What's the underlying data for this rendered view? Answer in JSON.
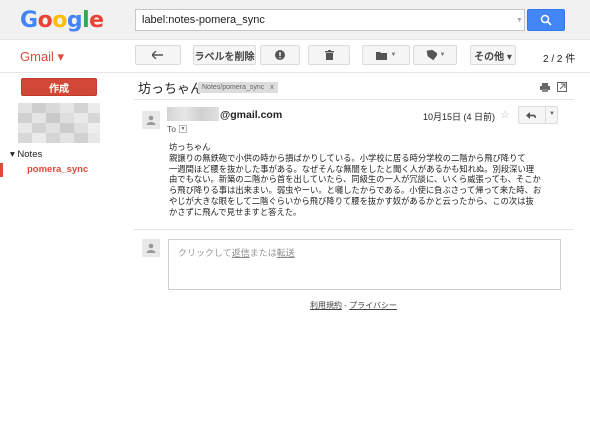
{
  "header": {
    "logo": {
      "letters": [
        "G",
        "o",
        "o",
        "g",
        "l",
        "e"
      ],
      "colors": [
        "#4285f4",
        "#ea4335",
        "#fbbc05",
        "#4285f4",
        "#34a853",
        "#ea4335"
      ]
    },
    "search_value": "label:notes-pomera_sync",
    "search_icon": "search-icon"
  },
  "toolbar": {
    "app_label": "Gmail ▾",
    "back_icon": "arrow-back-icon",
    "remove_label": "ラベルを削除",
    "report_icon": "report-spam-icon",
    "delete_icon": "trash-icon",
    "move_icon": "folder-icon",
    "labels_icon": "label-tag-icon",
    "more_label": "その他 ▾",
    "pager_text": "2 / 2 件"
  },
  "sidebar": {
    "compose_label": "作成",
    "notes_label": "▾ Notes",
    "sync_label": "pomera_sync"
  },
  "message": {
    "subject": "坊っちゃん",
    "label_chip": "Notes/pomera_sync",
    "label_chip_close": "x",
    "sender_domain": "@gmail.com",
    "to_label": "To",
    "date": "10月15日 (4 日前)",
    "star": "☆",
    "body_title": "坊っちゃん",
    "body_lines": [
      "親譲りの無鉄砲で小供の時から損ばかりしている。小学校に居る時分学校の二階から飛び降りて",
      "一週間ほど腰を抜かした事がある。なぜそんな無闇をしたと聞く人があるかも知れぬ。別段深い理",
      "由でもない。新築の二階から首を出していたら、同級生の一人が冗談に、いくら威張っても、そこか",
      "ら飛び降りる事は出来まい。弱虫やーい。と囃したからである。小使に負ぶさって帰って来た時、お",
      "やじが大きな眼をして二階ぐらいから飛び降りて腰を抜かす奴があるかと云ったから、この次は抜",
      "かさずに飛んで見せますと答えた。"
    ]
  },
  "reply": {
    "prefix": "クリックして",
    "reply_link": "返信",
    "middle": "または",
    "forward_link": "転送"
  },
  "footer": {
    "terms": "利用規約",
    "sep": " - ",
    "privacy": "プライバシー"
  }
}
